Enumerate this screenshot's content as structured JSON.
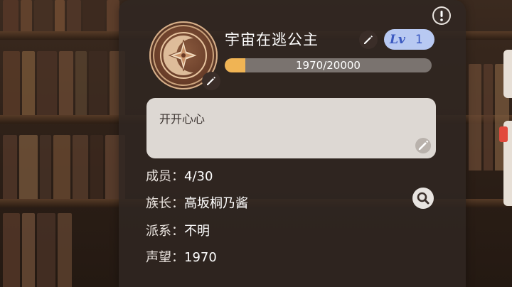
{
  "guild": {
    "name": "宇宙在逃公主",
    "level_label": "Lv",
    "level": "1",
    "xp_text": "1970/20000",
    "xp_progress": 0.0985,
    "motto": "开开心心",
    "info": [
      {
        "key": "members",
        "label": "成员：",
        "value": "4/30"
      },
      {
        "key": "leader",
        "label": "族长：",
        "value": "高坂桐乃酱"
      },
      {
        "key": "faction",
        "label": "派系：",
        "value": "不明"
      },
      {
        "key": "prestige",
        "label": "声望：",
        "value": "1970"
      }
    ]
  },
  "icons": {
    "alert": "exclamation-icon",
    "edit": "pencil-icon",
    "search": "magnifier-icon",
    "emblem": "star-moon-emblem"
  },
  "colors": {
    "panel": "#30262290",
    "xp_fill": "#f0b454",
    "level_badge": "#b8c9f2",
    "level_text": "#3a58c0"
  }
}
